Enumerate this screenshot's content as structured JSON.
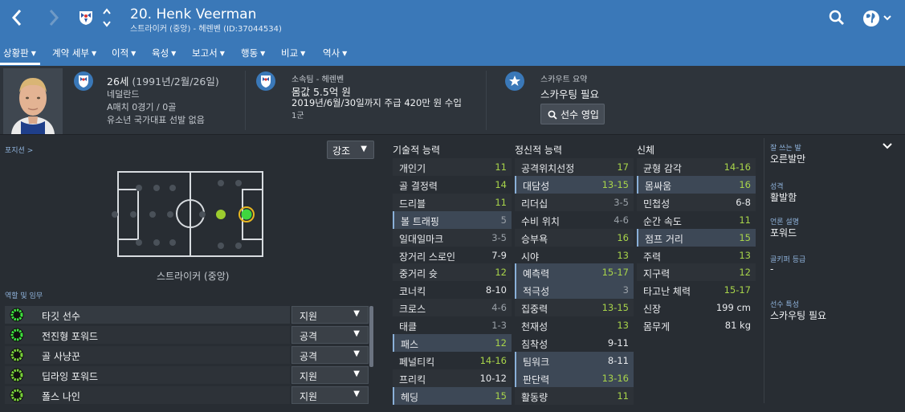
{
  "header": {
    "title": "20. Henk Veerman",
    "subtitle": "스트라이커 (중앙) - 헤렌벤 (ID:37044534)"
  },
  "menu": [
    "상황판",
    "계약 세부",
    "이적",
    "육성",
    "보고서",
    "행동",
    "비교",
    "역사"
  ],
  "profile": {
    "age": "26세",
    "dob": "(1991년/2월/26일)",
    "nationality": "네덜란드",
    "caps": "A매치 0경기 / 0골",
    "youth": "유소년 국가대표 선발 없음"
  },
  "club": {
    "label": "소속팀 - 헤렌벤",
    "value": "몸값 5.5억 원",
    "contract": "2019년/6월/30일까지 주급 420만 원 수입",
    "squad": "1군"
  },
  "scout": {
    "label": "스카우트 요약",
    "value": "스카우팅 필요",
    "button": "선수 영입"
  },
  "position": {
    "link": "포지션 >",
    "emphasis": "강조",
    "label": "스트라이커 (중앙)"
  },
  "roles": {
    "title": "역할 및 임무",
    "items": [
      {
        "name": "타깃 선수",
        "duty": "지원"
      },
      {
        "name": "전진형 포워드",
        "duty": "공격"
      },
      {
        "name": "골 사냥꾼",
        "duty": "공격"
      },
      {
        "name": "딥라잉 포워드",
        "duty": "지원"
      },
      {
        "name": "폴스 나인",
        "duty": "지원"
      }
    ]
  },
  "technical": {
    "title": "기술적 능력",
    "items": [
      {
        "name": "개인기",
        "value": "11",
        "color": "green"
      },
      {
        "name": "골 결정력",
        "value": "14",
        "color": "green"
      },
      {
        "name": "드리블",
        "value": "11",
        "color": "green"
      },
      {
        "name": "볼 트래핑",
        "value": "5",
        "color": "gray"
      },
      {
        "name": "일대일마크",
        "value": "3-5",
        "color": "gray"
      },
      {
        "name": "장거리 스로인",
        "value": "7-9",
        "color": "white"
      },
      {
        "name": "중거리 슛",
        "value": "12",
        "color": "green"
      },
      {
        "name": "코너킥",
        "value": "8-10",
        "color": "white"
      },
      {
        "name": "크로스",
        "value": "4-6",
        "color": "gray"
      },
      {
        "name": "태클",
        "value": "1-3",
        "color": "gray"
      },
      {
        "name": "패스",
        "value": "12",
        "color": "green"
      },
      {
        "name": "페널티킥",
        "value": "14-16",
        "color": "green"
      },
      {
        "name": "프리킥",
        "value": "10-12",
        "color": "white"
      },
      {
        "name": "헤딩",
        "value": "15",
        "color": "green"
      }
    ]
  },
  "mental": {
    "title": "정신적 능력",
    "items": [
      {
        "name": "공격위치선정",
        "value": "17",
        "color": "green"
      },
      {
        "name": "대담성",
        "value": "13-15",
        "color": "green"
      },
      {
        "name": "리더십",
        "value": "3-5",
        "color": "gray"
      },
      {
        "name": "수비 위치",
        "value": "4-6",
        "color": "gray"
      },
      {
        "name": "승부욕",
        "value": "16",
        "color": "green"
      },
      {
        "name": "시야",
        "value": "13",
        "color": "green"
      },
      {
        "name": "예측력",
        "value": "15-17",
        "color": "green"
      },
      {
        "name": "적극성",
        "value": "3",
        "color": "gray"
      },
      {
        "name": "집중력",
        "value": "13-15",
        "color": "green"
      },
      {
        "name": "천재성",
        "value": "13",
        "color": "green"
      },
      {
        "name": "침착성",
        "value": "9-11",
        "color": "white"
      },
      {
        "name": "팀워크",
        "value": "8-11",
        "color": "white"
      },
      {
        "name": "판단력",
        "value": "13-16",
        "color": "green"
      },
      {
        "name": "활동량",
        "value": "11",
        "color": "green"
      }
    ]
  },
  "physical": {
    "title": "신체",
    "items": [
      {
        "name": "균형 감각",
        "value": "14-16",
        "color": "green"
      },
      {
        "name": "몸싸움",
        "value": "16",
        "color": "green"
      },
      {
        "name": "민첩성",
        "value": "6-8",
        "color": "white"
      },
      {
        "name": "순간 속도",
        "value": "11",
        "color": "green"
      },
      {
        "name": "점프 거리",
        "value": "15",
        "color": "green"
      },
      {
        "name": "주력",
        "value": "13",
        "color": "green"
      },
      {
        "name": "지구력",
        "value": "12",
        "color": "green"
      },
      {
        "name": "타고난 체력",
        "value": "15-17",
        "color": "green"
      },
      {
        "name": "신장",
        "value": "199 cm",
        "color": "white"
      },
      {
        "name": "몸무게",
        "value": "81 kg",
        "color": "white"
      }
    ]
  },
  "info": [
    {
      "label": "잘 쓰는 발",
      "value": "오른발만"
    },
    {
      "label": "성격",
      "value": "활발함"
    },
    {
      "label": "언론 설명",
      "value": "포워드"
    },
    {
      "label": "골키퍼 등급",
      "value": "-"
    },
    {
      "label": "선수 특성",
      "value": "스카우팅 필요"
    }
  ],
  "colors": {
    "green": "#a8d44a",
    "gray": "#9aa1a8",
    "white": "#e8eaed",
    "header": "#3a78b8"
  }
}
